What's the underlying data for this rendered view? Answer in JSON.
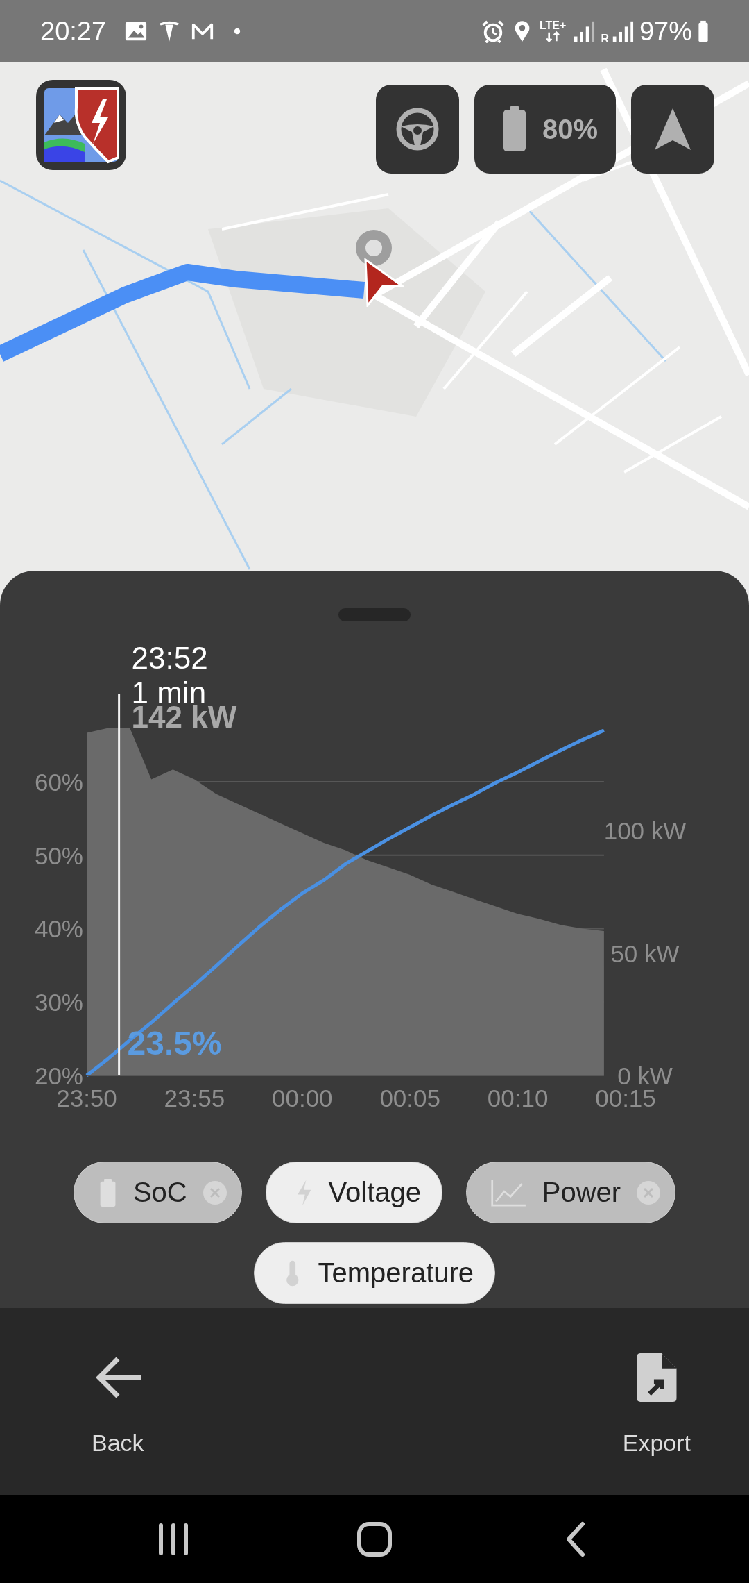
{
  "status_bar": {
    "time": "20:27",
    "network": "LTE+",
    "roaming": "R",
    "battery": "97%"
  },
  "map_controls": [
    {
      "kind": "steering"
    },
    {
      "kind": "battery",
      "label": "80%"
    },
    {
      "kind": "navigate"
    }
  ],
  "chart": {
    "cursor": {
      "time": "23:52",
      "duration": "1 min"
    },
    "chart_data": {
      "type": "line",
      "categories": [
        "23:50",
        null,
        null,
        null,
        null,
        "23:55",
        null,
        null,
        null,
        null,
        "00:00",
        null,
        null,
        null,
        null,
        "00:05",
        null,
        null,
        null,
        null,
        "00:10",
        null,
        null,
        null,
        null,
        "00:15"
      ],
      "grid": true,
      "series": [
        {
          "type": "area",
          "axis": "y2",
          "color": "#6a6a6a",
          "values": [
            140,
            142,
            142,
            121,
            125,
            121,
            115,
            111,
            107,
            103,
            99,
            95,
            92,
            88,
            85,
            82,
            78,
            75,
            72,
            69,
            66,
            64,
            61.5,
            60,
            59,
            null
          ]
        },
        {
          "type": "line",
          "color": "#4a90e2",
          "values": [
            20,
            22.3,
            24.8,
            27.2,
            29.8,
            32.3,
            34.9,
            37.6,
            40.2,
            42.6,
            44.8,
            46.6,
            48.8,
            50.5,
            52.2,
            53.8,
            55.4,
            56.9,
            58.3,
            59.9,
            61.3,
            62.8,
            64.3,
            65.7,
            67,
            null
          ]
        }
      ],
      "ylim": [
        20,
        72
      ],
      "y2lim": [
        0,
        156
      ],
      "yticks": [
        {
          "value": 20,
          "label": "20%"
        },
        {
          "value": 30,
          "label": "30%"
        },
        {
          "value": 40,
          "label": "40%"
        },
        {
          "value": 50,
          "label": "50%"
        },
        {
          "value": 60,
          "label": "60%"
        }
      ],
      "y2ticks": [
        {
          "value": 0,
          "label": "0 kW"
        },
        {
          "value": 50,
          "label": "50 kW"
        },
        {
          "value": 100,
          "label": "100 kW"
        }
      ],
      "annotations": [
        {
          "text": "142 kW"
        },
        {
          "text": "23.5%"
        }
      ]
    }
  },
  "chips": [
    {
      "label": "SoC",
      "kind": "soc",
      "selected": true
    },
    {
      "label": "Voltage",
      "kind": "voltage",
      "selected": false
    },
    {
      "label": "Power",
      "kind": "power",
      "selected": true
    },
    {
      "label": "Temperature",
      "kind": "temperature",
      "selected": false
    }
  ],
  "actions": [
    {
      "label": "Back",
      "kind": "back"
    },
    {
      "label": "Export",
      "kind": "export"
    }
  ]
}
